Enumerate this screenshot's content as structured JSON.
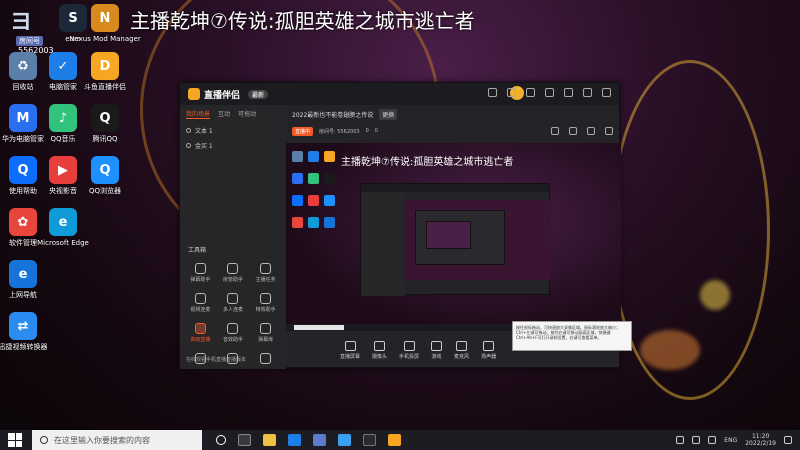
{
  "stream_title": "主播乾坤⑦传说:孤胆英雄之城市逃亡者",
  "room_badge": {
    "tag": "房间号",
    "number": "5562003"
  },
  "desktop_icons": [
    {
      "label": "eam",
      "name": "steam-icon",
      "color": "#1b2838",
      "glyph": "S"
    },
    {
      "label": "Nexus Mod Manager",
      "name": "nexus-mod-manager-icon",
      "color": "#d98a1e",
      "glyph": "N"
    },
    {
      "label": "回收站",
      "name": "recycle-bin-icon",
      "color": "#5a7fa8",
      "glyph": "♻"
    },
    {
      "label": "电脑管家",
      "name": "pc-manager-icon",
      "color": "#1e7ee8",
      "glyph": "✓"
    },
    {
      "label": "斗鱼直播伴侣",
      "name": "douyu-companion-icon",
      "color": "#f5a623",
      "glyph": "D"
    },
    {
      "label": "华为电脑管家",
      "name": "huawei-pc-manager-icon",
      "color": "#2a6ff0",
      "glyph": "M"
    },
    {
      "label": "QQ音乐",
      "name": "qq-music-icon",
      "color": "#31c27c",
      "glyph": "♪"
    },
    {
      "label": "腾讯QQ",
      "name": "tencent-qq-icon",
      "color": "#1a1a1a",
      "glyph": "Q"
    },
    {
      "label": "使用帮助",
      "name": "help-icon",
      "color": "#0d6efd",
      "glyph": "Q"
    },
    {
      "label": "央视影音",
      "name": "cctv-video-icon",
      "color": "#e83e3e",
      "glyph": "▶"
    },
    {
      "label": "QQ浏览器",
      "name": "qq-browser-icon",
      "color": "#1e90ff",
      "glyph": "Q"
    },
    {
      "label": "软件管理",
      "name": "software-manager-icon",
      "color": "#e8453c",
      "glyph": "✿"
    },
    {
      "label": "Microsoft Edge",
      "name": "edge-icon",
      "color": "#0f9bd7",
      "glyph": "e"
    },
    {
      "label": "上网导航",
      "name": "web-nav-icon",
      "color": "#1673d9",
      "glyph": "e"
    },
    {
      "label": "迅捷视频转换器",
      "name": "video-converter-icon",
      "color": "#2a8cf0",
      "glyph": "⇄"
    }
  ],
  "app": {
    "brand": "直播伴侣",
    "version": "最新",
    "tabs": [
      "我的场景",
      "互动",
      "可拖动"
    ],
    "scenes": [
      "文本 1",
      "金买 1"
    ],
    "toolbox_label": "工具箱",
    "tools": [
      {
        "label": "弹幕助手"
      },
      {
        "label": "房管助手"
      },
      {
        "label": "主播任务"
      },
      {
        "label": "视频连麦"
      },
      {
        "label": "多人连麦"
      },
      {
        "label": "特效助手"
      },
      {
        "label": "高级直播",
        "hot": true
      },
      {
        "label": "音效助手"
      },
      {
        "label": "弹幕库"
      },
      {
        "label": ""
      },
      {
        "label": ""
      },
      {
        "label": ""
      }
    ],
    "left_footer": "在线观看手机直播首播版本",
    "info_title": "2022最新也不能卷翅膀之传说",
    "info_pill": "更换",
    "sub": {
      "live": "直播中",
      "room": "房间号: 5562003",
      "hot": "0",
      "count": "0"
    },
    "preview_title": "主播乾坤⑦传说:孤胆英雄之城市逃亡者",
    "controls": [
      "直播屏幕",
      "摄像头",
      "手机投屏",
      "游戏",
      "麦克风",
      "扬声器"
    ]
  },
  "tooltip": "按住鼠标拖动，可快速放大录像区域。鼠标滚轮放大缩小；Ctrl+左键可拖动，按住右键可移动画面区域，快捷键Ctrl+Alt+F可打开录制设置，右键可查看菜单。",
  "taskbar": {
    "search_placeholder": "在这里输入你要搜索的内容",
    "lang": "ENG",
    "time": "11:20",
    "date": "2022/2/19"
  }
}
